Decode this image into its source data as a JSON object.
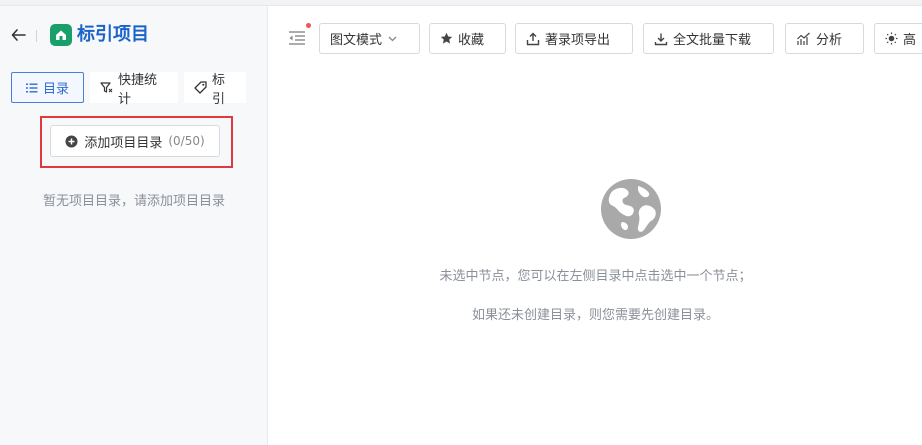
{
  "sidebar": {
    "title": "标引项目",
    "tabs": [
      {
        "label": "目录",
        "icon": "list-icon"
      },
      {
        "label": "快捷统计",
        "icon": "filter-icon"
      },
      {
        "label": "标引",
        "icon": "tag-icon"
      }
    ],
    "add_button": {
      "label": "添加项目目录",
      "count": "(0/50)"
    },
    "empty_message": "暂无项目目录，请添加项目目录"
  },
  "toolbar": {
    "view_mode": "图文模式",
    "buttons": [
      {
        "label": "收藏",
        "icon": "star-icon"
      },
      {
        "label": "著录项导出",
        "icon": "export-icon"
      },
      {
        "label": "全文批量下载",
        "icon": "download-icon"
      },
      {
        "label": "分析",
        "icon": "analysis-icon"
      },
      {
        "label": "高",
        "icon": "sun-icon"
      }
    ]
  },
  "main": {
    "hint_line1": "未选中节点，您可以在左侧目录中点击选中一个节点；",
    "hint_line2": "如果还未创建目录，则您需要先创建目录。"
  },
  "colors": {
    "accent": "#1b63c9",
    "logo": "#19a06a",
    "highlight": "#e0393e"
  }
}
